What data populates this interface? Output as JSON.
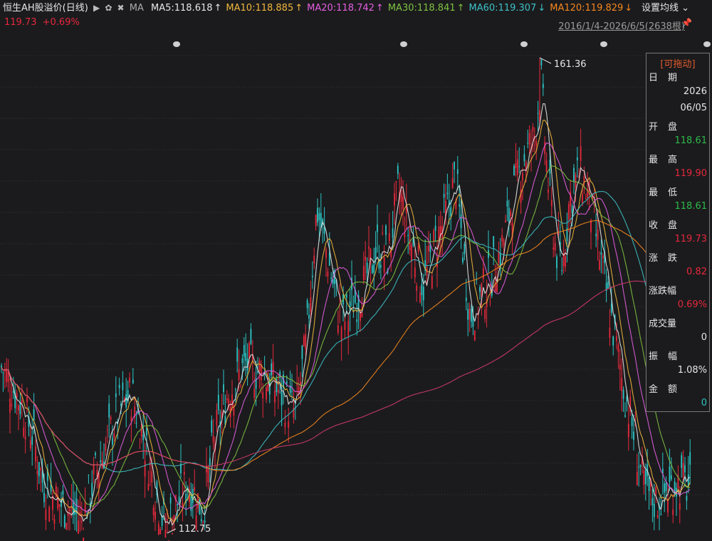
{
  "header": {
    "title": "恒生AH股溢价(日线)",
    "ma_label": "MA",
    "ma": [
      {
        "label": "MA5:118.618",
        "arrow": "↑",
        "color": "#e6e6e6"
      },
      {
        "label": "MA10:118.885",
        "arrow": "↑",
        "color": "#f0b63c"
      },
      {
        "label": "MA20:118.742",
        "arrow": "↑",
        "color": "#e35ee0"
      },
      {
        "label": "MA30:118.841",
        "arrow": "↑",
        "color": "#7fc241"
      },
      {
        "label": "MA60:119.307",
        "arrow": "↓",
        "color": "#3cc1c8"
      },
      {
        "label": "MA120:119.829",
        "arrow": "↓",
        "color": "#f5871f"
      }
    ],
    "settings_label": "设置均线",
    "price": "119.73",
    "change_pct": "+0.69%",
    "range_label": "2016/1/4-2026/6/5(2638根)"
  },
  "chart_data": {
    "type": "candlestick",
    "max_marker": "161.36",
    "min_marker": "112.75",
    "price_max": 161.36,
    "price_min": 112.75,
    "up_color": "#e6283c",
    "down_color": "#2cc5c5",
    "ma_colors": [
      "#e6e6e6",
      "#f0b63c",
      "#e35ee0",
      "#7fc241",
      "#3cc1c8",
      "#f5871f",
      "#d43a6a"
    ]
  },
  "infobox": {
    "header": "[可拖动]",
    "date_label": "日期",
    "year": "2026",
    "date": "06/05",
    "open_label": "开盘",
    "open": "118.61",
    "high_label": "最高",
    "high": "119.90",
    "low_label": "最低",
    "low": "118.61",
    "close_label": "收盘",
    "close": "119.73",
    "change_label": "涨跌",
    "change": "0.82",
    "changepct_label": "涨跌幅",
    "changepct": "0.69%",
    "volume_label": "成交量",
    "volume": "0",
    "amplitude_label": "振幅",
    "amplitude": "1.08%",
    "amount_label": "金额",
    "amount": "0"
  }
}
